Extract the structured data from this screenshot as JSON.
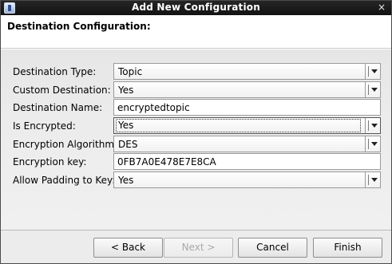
{
  "window": {
    "title": "Add New Configuration",
    "close_label": "×"
  },
  "header": {
    "heading": "Destination Configuration:"
  },
  "form": {
    "destination_type": {
      "label": "Destination Type:",
      "value": "Topic"
    },
    "custom_destination": {
      "label": "Custom Destination:",
      "value": "Yes"
    },
    "destination_name": {
      "label": "Destination Name:",
      "value": "encryptedtopic"
    },
    "is_encrypted": {
      "label": "Is Encrypted:",
      "value": "Yes"
    },
    "encryption_algorithm": {
      "label": "Encryption Algorithm:",
      "value": "DES"
    },
    "encryption_key": {
      "label": "Encryption key:",
      "value": "0FB7A0E478E7E8CA"
    },
    "allow_padding": {
      "label": "Allow Padding to Key:",
      "value": "Yes"
    }
  },
  "buttons": {
    "back": "< Back",
    "next": "Next >",
    "cancel": "Cancel",
    "finish": "Finish"
  },
  "icons": {
    "app": "app-icon",
    "close": "close-icon",
    "dropdown": "chevron-down-icon"
  }
}
